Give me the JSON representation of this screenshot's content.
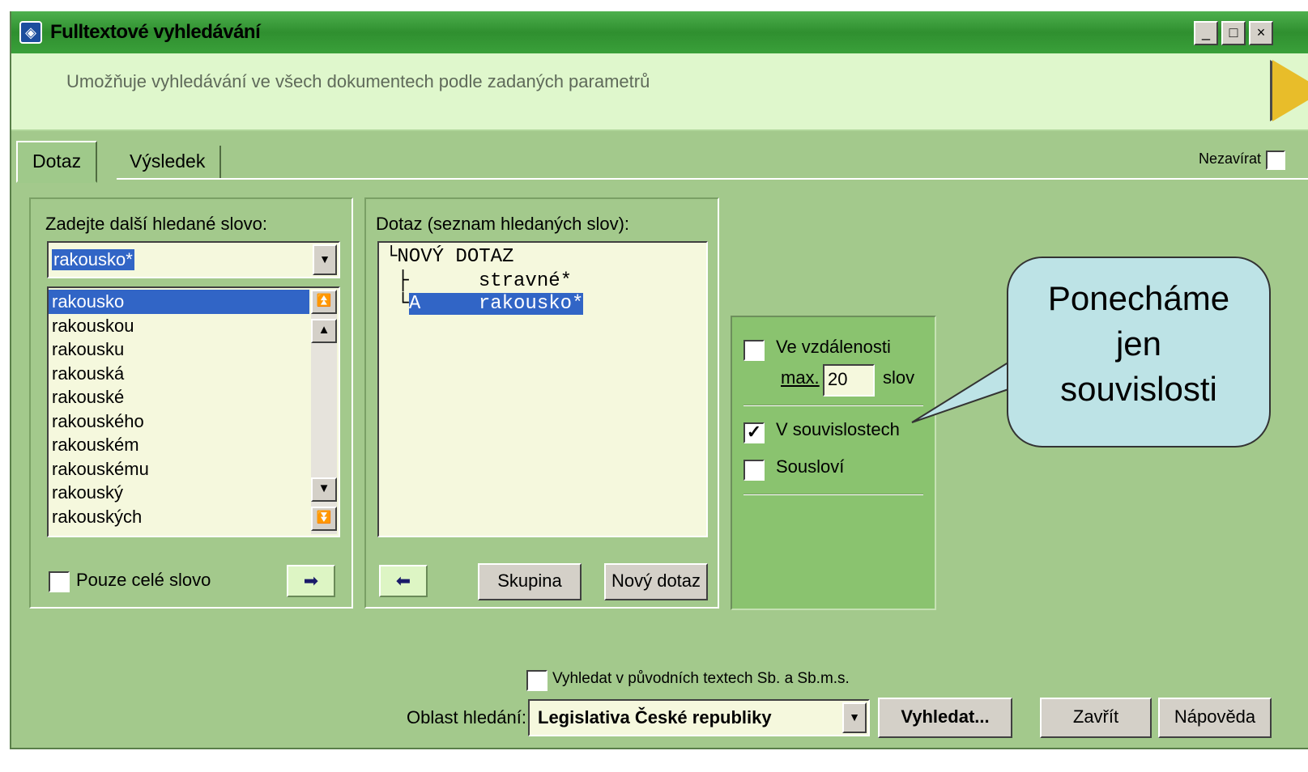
{
  "window": {
    "title": "Fulltextové vyhledávání",
    "description": "Umožňuje vyhledávání ve všech dokumentech podle zadaných parametrů",
    "controls": {
      "minimize": "_",
      "maximize": "□",
      "close": "×"
    }
  },
  "tabs": [
    {
      "label": "Dotaz",
      "active": true
    },
    {
      "label": "Výsledek",
      "active": false
    }
  ],
  "nezavirat": {
    "label": "Nezavírat",
    "checked": false
  },
  "word_panel": {
    "label": "Zadejte další hledané slovo:",
    "input_value": "rakousko*",
    "suggestions": [
      "rakousko",
      "rakouskou",
      "rakousku",
      "rakouská",
      "rakouské",
      "rakouského",
      "rakouském",
      "rakouskému",
      "rakouský",
      "rakouských"
    ],
    "selected_index": 0,
    "whole_word": {
      "label": "Pouze celé slovo",
      "checked": false
    }
  },
  "query_panel": {
    "label": "Dotaz (seznam hledaných slov):",
    "tree": {
      "root": "└NOVÝ DOTAZ",
      "lines": [
        {
          "prefix": " ├",
          "op": "",
          "word": "stravné*"
        },
        {
          "prefix": " └",
          "op": "A",
          "word": "rakousko*"
        }
      ]
    },
    "buttons": {
      "group": "Skupina",
      "new_query": "Nový dotaz"
    }
  },
  "options_panel": {
    "distance": {
      "label": "Ve vzdálenosti",
      "checked": false,
      "max_label": "max.",
      "max_value": "20",
      "unit": "slov"
    },
    "context": {
      "label": "V souvislostech",
      "checked": true
    },
    "phrase": {
      "label": "Sousloví",
      "checked": false
    }
  },
  "callout": {
    "text": "Ponecháme\njen\nsouvislosti"
  },
  "bottom": {
    "original_texts": {
      "label": "Vyhledat v původních textech Sb. a Sb.m.s.",
      "checked": false
    },
    "area_label": "Oblast hledání:",
    "area_value": "Legislativa České republiky",
    "search_button": "Vyhledat...",
    "close_button": "Zavřít",
    "help_button": "Nápověda"
  },
  "colors": {
    "title_bar": "#3aa03a",
    "body": "#a3c98c",
    "description_bar": "#dff7cc",
    "selection": "#3165c6",
    "callout": "#bde3e6",
    "play_icon": "#e8bd2a"
  }
}
